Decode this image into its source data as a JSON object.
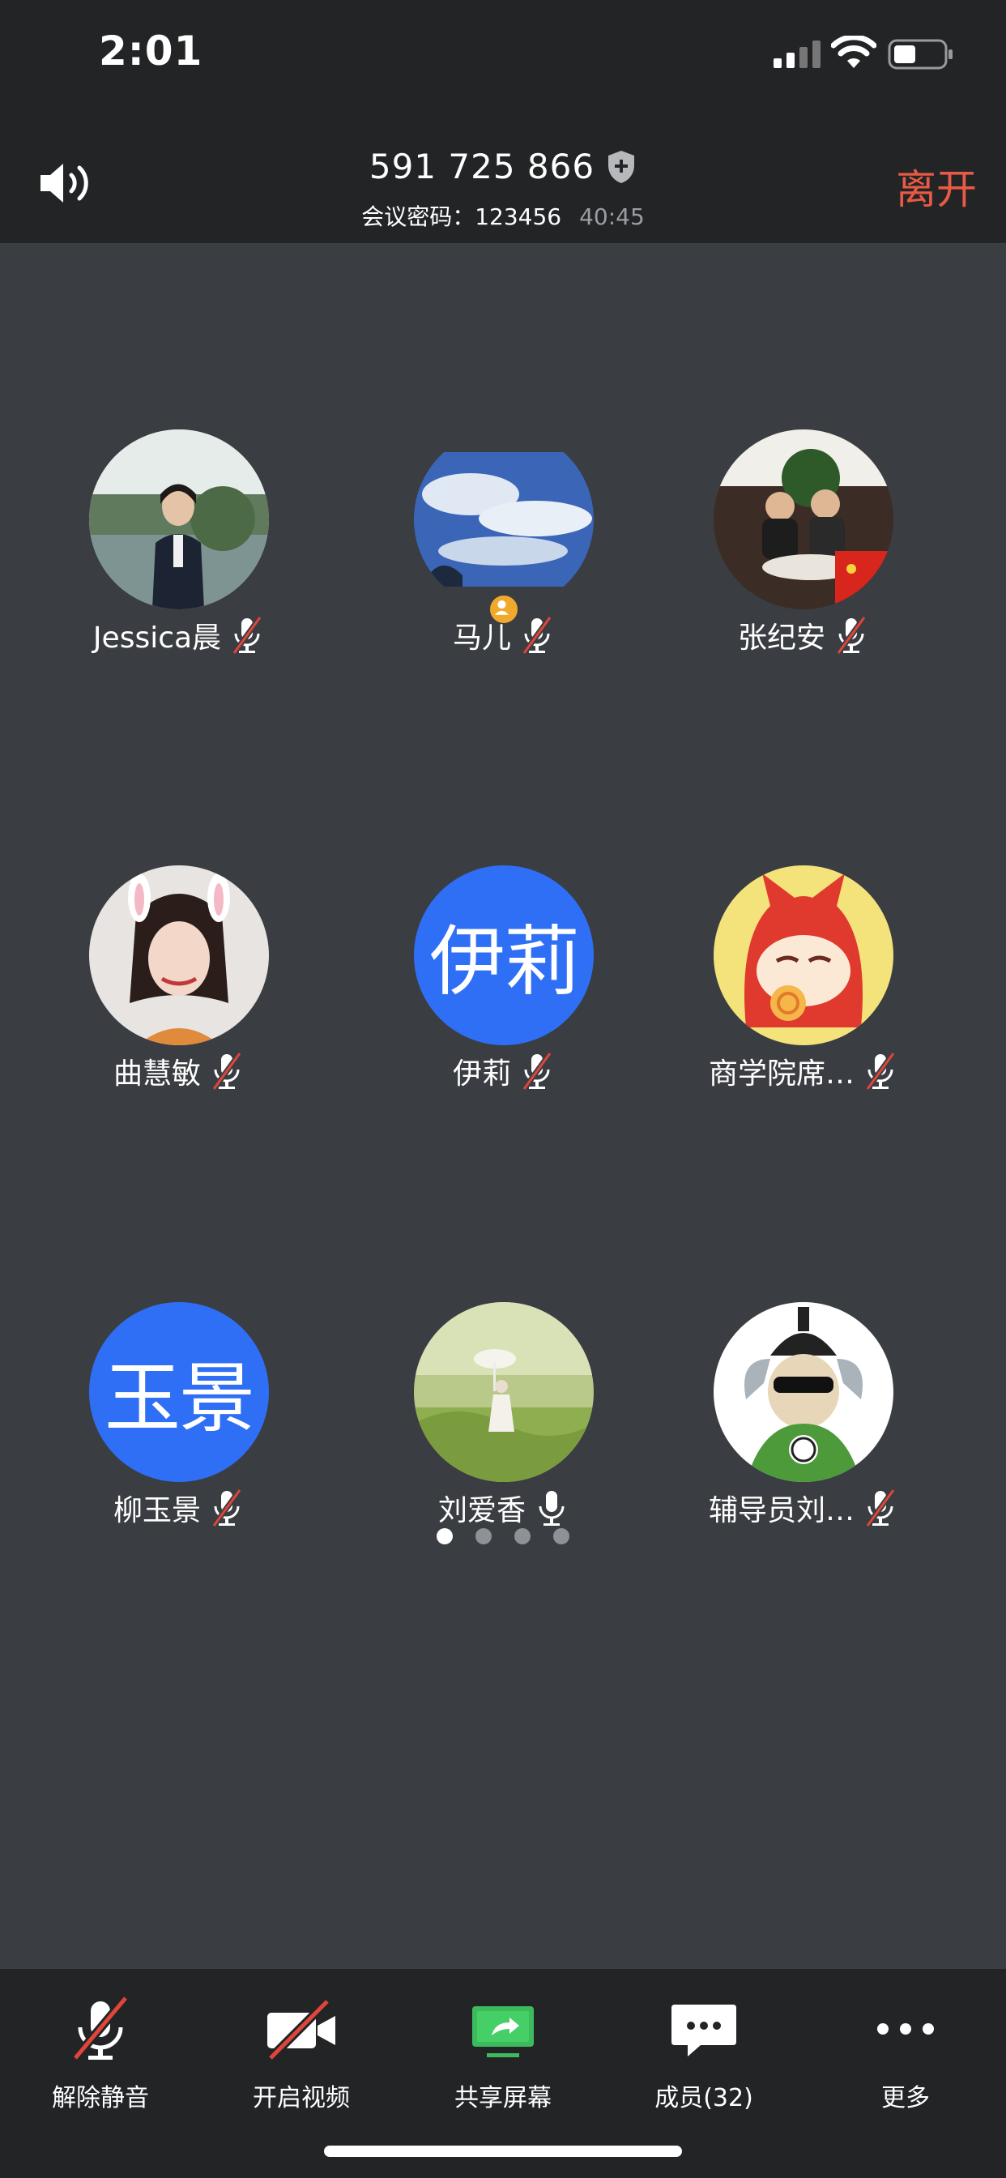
{
  "status_bar": {
    "time": "2:01"
  },
  "header": {
    "meeting_id": "591 725 866",
    "password_label": "会议密码：123456",
    "duration": "40:45",
    "leave_label": "离开"
  },
  "participants": [
    {
      "name": "Jessica晨",
      "mic": "muted"
    },
    {
      "name": "马儿",
      "mic": "muted",
      "host": true
    },
    {
      "name": "张纪安",
      "mic": "muted"
    },
    {
      "name": "曲慧敏",
      "mic": "muted"
    },
    {
      "name": "伊莉",
      "mic": "muted",
      "avatar_text": "伊莉"
    },
    {
      "name": "商学院席…",
      "mic": "muted"
    },
    {
      "name": "柳玉景",
      "mic": "muted",
      "avatar_text": "玉景"
    },
    {
      "name": "刘爱香",
      "mic": "on"
    },
    {
      "name": "辅导员刘…",
      "mic": "muted"
    }
  ],
  "pagination": {
    "pages": 4,
    "current": 1
  },
  "toolbar": {
    "unmute_label": "解除静音",
    "video_label": "开启视频",
    "share_label": "共享屏幕",
    "members_label": "成员(32)",
    "more_label": "更多"
  },
  "colors": {
    "background": "#3a3d41",
    "bar": "#232426",
    "leave": "#e85a45",
    "avatar_blue": "#2f6ff5",
    "share_green": "#3dbb5c",
    "mute_slash": "#e0453a"
  }
}
